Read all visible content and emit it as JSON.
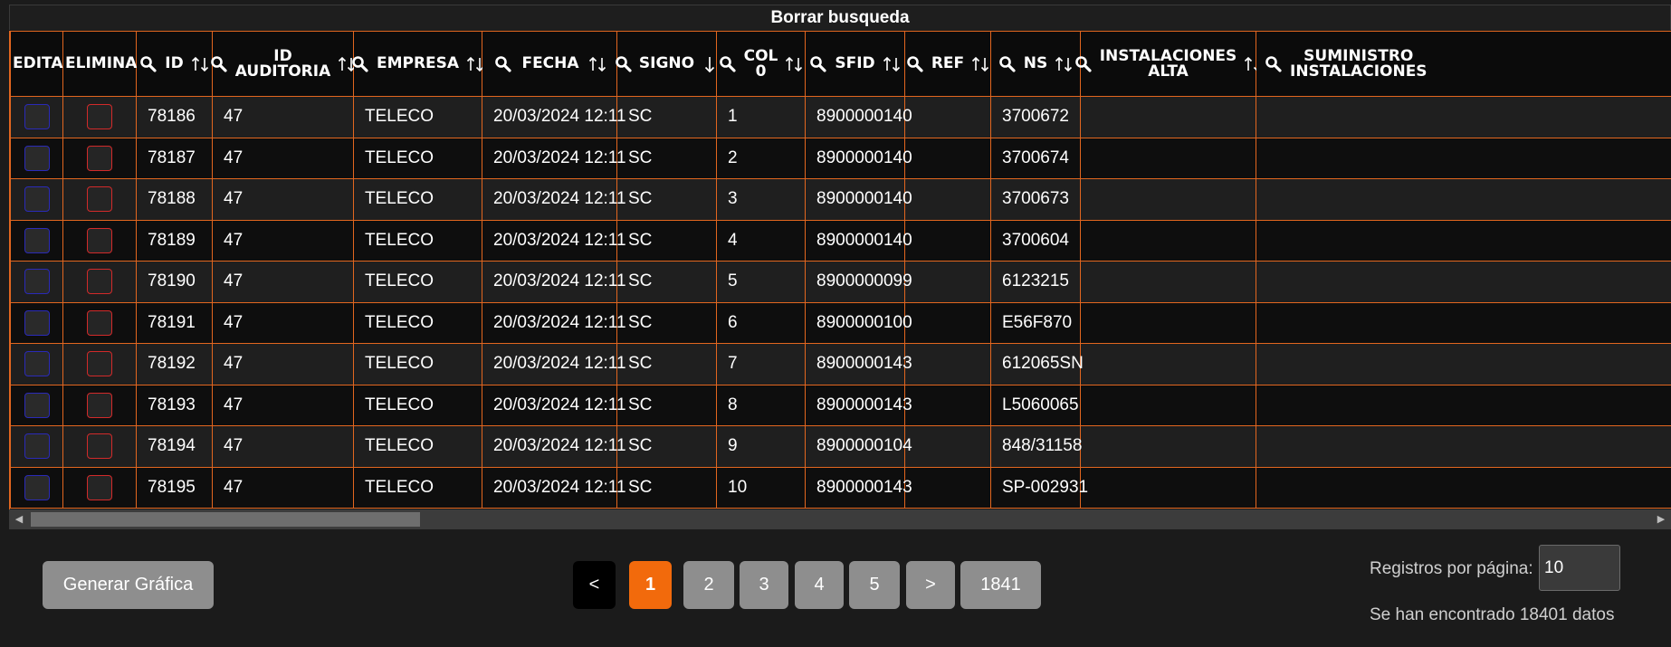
{
  "clear_search_label": "Borrar busqueda",
  "columns": {
    "editar": "EDITAR",
    "eliminar": "ELIMINAR",
    "id": "ID",
    "id_auditoria_1": "ID",
    "id_auditoria_2": "AUDITORIA",
    "empresa": "EMPRESA",
    "fecha": "FECHA",
    "signo": "SIGNO",
    "col0_1": "COL",
    "col0_2": "0",
    "sfid": "SFID",
    "ref": "REF",
    "ns": "NS",
    "instalaciones_alta_1": "INSTALACIONES",
    "instalaciones_alta_2": "ALTA",
    "suministro_1": "SUMINISTRO",
    "suministro_2": "INSTALACIONES"
  },
  "rows": [
    {
      "id": "78186",
      "auditoria": "47",
      "empresa": "TELECO",
      "fecha": "20/03/2024 12:11",
      "signo": "SC",
      "col0": "1",
      "sfid": "8900000140",
      "ref": "",
      "ns": "3700672",
      "inst_alta": "",
      "suministro": ""
    },
    {
      "id": "78187",
      "auditoria": "47",
      "empresa": "TELECO",
      "fecha": "20/03/2024 12:11",
      "signo": "SC",
      "col0": "2",
      "sfid": "8900000140",
      "ref": "",
      "ns": "3700674",
      "inst_alta": "",
      "suministro": ""
    },
    {
      "id": "78188",
      "auditoria": "47",
      "empresa": "TELECO",
      "fecha": "20/03/2024 12:11",
      "signo": "SC",
      "col0": "3",
      "sfid": "8900000140",
      "ref": "",
      "ns": "3700673",
      "inst_alta": "",
      "suministro": ""
    },
    {
      "id": "78189",
      "auditoria": "47",
      "empresa": "TELECO",
      "fecha": "20/03/2024 12:11",
      "signo": "SC",
      "col0": "4",
      "sfid": "8900000140",
      "ref": "",
      "ns": "3700604",
      "inst_alta": "",
      "suministro": ""
    },
    {
      "id": "78190",
      "auditoria": "47",
      "empresa": "TELECO",
      "fecha": "20/03/2024 12:11",
      "signo": "SC",
      "col0": "5",
      "sfid": "8900000099",
      "ref": "",
      "ns": "6123215",
      "inst_alta": "",
      "suministro": ""
    },
    {
      "id": "78191",
      "auditoria": "47",
      "empresa": "TELECO",
      "fecha": "20/03/2024 12:11",
      "signo": "SC",
      "col0": "6",
      "sfid": "8900000100",
      "ref": "",
      "ns": "E56F870",
      "inst_alta": "",
      "suministro": ""
    },
    {
      "id": "78192",
      "auditoria": "47",
      "empresa": "TELECO",
      "fecha": "20/03/2024 12:11",
      "signo": "SC",
      "col0": "7",
      "sfid": "8900000143",
      "ref": "",
      "ns": "612065SN",
      "inst_alta": "",
      "suministro": ""
    },
    {
      "id": "78193",
      "auditoria": "47",
      "empresa": "TELECO",
      "fecha": "20/03/2024 12:11",
      "signo": "SC",
      "col0": "8",
      "sfid": "8900000143",
      "ref": "",
      "ns": "L5060065",
      "inst_alta": "",
      "suministro": ""
    },
    {
      "id": "78194",
      "auditoria": "47",
      "empresa": "TELECO",
      "fecha": "20/03/2024 12:11",
      "signo": "SC",
      "col0": "9",
      "sfid": "8900000104",
      "ref": "",
      "ns": "848/31158",
      "inst_alta": "",
      "suministro": ""
    },
    {
      "id": "78195",
      "auditoria": "47",
      "empresa": "TELECO",
      "fecha": "20/03/2024 12:11",
      "signo": "SC",
      "col0": "10",
      "sfid": "8900000143",
      "ref": "",
      "ns": "SP-002931",
      "inst_alta": "",
      "suministro": ""
    }
  ],
  "generate_chart_label": "Generar Gráfica",
  "pagination": {
    "prev": "<",
    "pages": [
      "1",
      "2",
      "3",
      "4",
      "5"
    ],
    "next": ">",
    "last": "1841",
    "active_page": "1"
  },
  "records_per_page_label": "Registros por página:",
  "records_per_page_value": "10",
  "total_text": "Se han encontrado 18401 datos",
  "colors": {
    "accent": "#f26a0c",
    "border": "#e2661f",
    "edit_box": "#2a2ab8",
    "delete_box": "#d22a2a"
  }
}
